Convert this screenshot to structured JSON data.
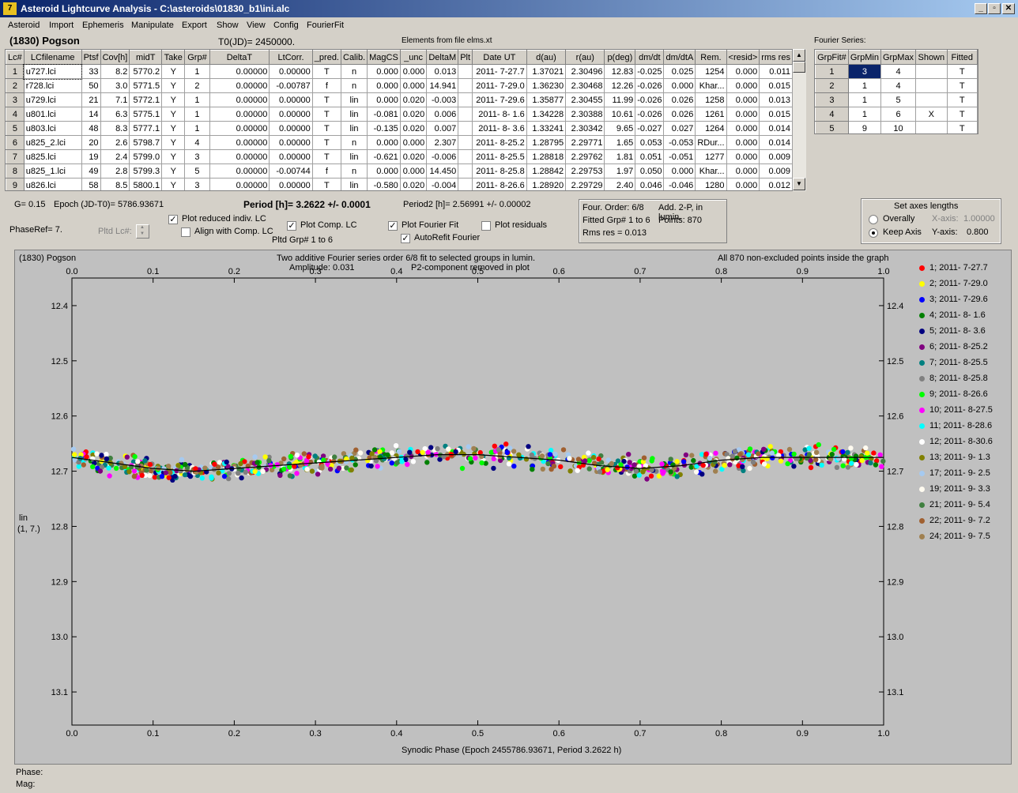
{
  "window": {
    "title": "Asteroid Lightcurve Analysis - C:\\asteroids\\01830_b1\\ini.alc",
    "app_icon": "7"
  },
  "menu": [
    "Asteroid",
    "Import",
    "Ephemeris",
    "Manipulate",
    "Export",
    "Show",
    "View",
    "Config",
    "FourierFit"
  ],
  "header": {
    "asteroid": "(1830) Pogson",
    "t0": "T0(JD)= 2450000.",
    "elements": "Elements from file elms.xt",
    "fourier_label": "Fourier Series:"
  },
  "lc_table": {
    "columns": [
      "Lc#",
      "LCfilename",
      "Ptsf",
      "Cov[h]",
      "midT",
      "Take",
      "Grp#",
      "DeltaT",
      "LtCorr.",
      "_pred.",
      "Calib.",
      "MagCS",
      "_unc",
      "DeltaM",
      "Plt",
      "Date UT",
      "d(au)",
      "r(au)",
      "p(deg)",
      "dm/dt",
      "dm/dtA",
      "Rem.",
      "<resid>",
      "rms res"
    ],
    "rows": [
      [
        "1",
        "u727.lci",
        "33",
        "8.2",
        "5770.2",
        "Y",
        "1",
        "0.00000",
        "0.00000",
        "T",
        "n",
        "0.000",
        "0.000",
        "0.013",
        "",
        "2011- 7-27.7",
        "1.37021",
        "2.30496",
        "12.83",
        "-0.025",
        "0.025",
        "1254",
        "0.000",
        "0.011"
      ],
      [
        "2",
        "r728.lci",
        "50",
        "3.0",
        "5771.5",
        "Y",
        "2",
        "0.00000",
        "-0.00787",
        "f",
        "n",
        "0.000",
        "0.000",
        "14.941",
        "",
        "2011- 7-29.0",
        "1.36230",
        "2.30468",
        "12.26",
        "-0.026",
        "0.000",
        "Khar...",
        "0.000",
        "0.015"
      ],
      [
        "3",
        "u729.lci",
        "21",
        "7.1",
        "5772.1",
        "Y",
        "1",
        "0.00000",
        "0.00000",
        "T",
        "lin",
        "0.000",
        "0.020",
        "-0.003",
        "",
        "2011- 7-29.6",
        "1.35877",
        "2.30455",
        "11.99",
        "-0.026",
        "0.026",
        "1258",
        "0.000",
        "0.013"
      ],
      [
        "4",
        "u801.lci",
        "14",
        "6.3",
        "5775.1",
        "Y",
        "1",
        "0.00000",
        "0.00000",
        "T",
        "lin",
        "-0.081",
        "0.020",
        "0.006",
        "",
        "2011- 8- 1.6",
        "1.34228",
        "2.30388",
        "10.61",
        "-0.026",
        "0.026",
        "1261",
        "0.000",
        "0.015"
      ],
      [
        "5",
        "u803.lci",
        "48",
        "8.3",
        "5777.1",
        "Y",
        "1",
        "0.00000",
        "0.00000",
        "T",
        "lin",
        "-0.135",
        "0.020",
        "0.007",
        "",
        "2011- 8- 3.6",
        "1.33241",
        "2.30342",
        "9.65",
        "-0.027",
        "0.027",
        "1264",
        "0.000",
        "0.014"
      ],
      [
        "6",
        "u825_2.lci",
        "20",
        "2.6",
        "5798.7",
        "Y",
        "4",
        "0.00000",
        "0.00000",
        "T",
        "n",
        "0.000",
        "0.000",
        "2.307",
        "",
        "2011- 8-25.2",
        "1.28795",
        "2.29771",
        "1.65",
        "0.053",
        "-0.053",
        "RDur...",
        "0.000",
        "0.014"
      ],
      [
        "7",
        "u825.lci",
        "19",
        "2.4",
        "5799.0",
        "Y",
        "3",
        "0.00000",
        "0.00000",
        "T",
        "lin",
        "-0.621",
        "0.020",
        "-0.006",
        "",
        "2011- 8-25.5",
        "1.28818",
        "2.29762",
        "1.81",
        "0.051",
        "-0.051",
        "1277",
        "0.000",
        "0.009"
      ],
      [
        "8",
        "u825_1.lci",
        "49",
        "2.8",
        "5799.3",
        "Y",
        "5",
        "0.00000",
        "-0.00744",
        "f",
        "n",
        "0.000",
        "0.000",
        "14.450",
        "",
        "2011- 8-25.8",
        "1.28842",
        "2.29753",
        "1.97",
        "0.050",
        "0.000",
        "Khar...",
        "0.000",
        "0.009"
      ],
      [
        "9",
        "u826.lci",
        "58",
        "8.5",
        "5800.1",
        "Y",
        "3",
        "0.00000",
        "0.00000",
        "T",
        "lin",
        "-0.580",
        "0.020",
        "-0.004",
        "",
        "2011- 8-26.6",
        "1.28920",
        "2.29729",
        "2.40",
        "0.046",
        "-0.046",
        "1280",
        "0.000",
        "0.012"
      ]
    ]
  },
  "fourier_table": {
    "columns": [
      "GrpFit#",
      "GrpMin",
      "GrpMax",
      "Shown",
      "Fitted"
    ],
    "rows": [
      [
        "1",
        "3",
        "4",
        "",
        "T"
      ],
      [
        "2",
        "1",
        "4",
        "",
        "T"
      ],
      [
        "3",
        "1",
        "5",
        "",
        "T"
      ],
      [
        "4",
        "1",
        "6",
        "X",
        "T"
      ],
      [
        "5",
        "9",
        "10",
        "",
        "T"
      ]
    ]
  },
  "controls": {
    "g": "G= 0.15",
    "epoch": "Epoch (JD-T0)= 5786.93671",
    "period": "Period [h]= 3.2622 +/- 0.0001",
    "period2": "Period2 [h]= 2.56991 +/- 0.00002",
    "phaseref": "PhaseRef= 7.",
    "pltd_lc": "Pltd Lc#:",
    "plot_reduced": "Plot reduced indiv. LC",
    "align_comp": "Align with Comp. LC",
    "plot_comp": "Plot Comp. LC",
    "pltd_grp": "Pltd Grp#  1   to   6",
    "plot_fourier": "Plot Fourier Fit",
    "autorefit": "AutoRefit Fourier",
    "plot_resid": "Plot residuals",
    "check_mark": "✓",
    "x_mark": "X"
  },
  "fit_info": {
    "order": "Four. Order:  6/8",
    "add": "Add. 2-P, in lumin.",
    "fitted": "Fitted Grp# 1 to 6",
    "points": "Points: 870",
    "rms": "Rms res      = 0.013"
  },
  "axes_box": {
    "title": "Set axes lengths",
    "overally": "Overally",
    "keep": "Keep Axis",
    "xaxis": "X-axis:",
    "xval": "1.00000",
    "yaxis": "Y-axis:",
    "yval": "0.800"
  },
  "plot": {
    "left_title": "(1830) Pogson",
    "center_title1": "Two additive Fourier series order 6/8 fit to selected groups in lumin.",
    "center_title2_a": "Amplitude: 0.031",
    "center_title2_b": "P2-component removed in plot",
    "right_title": "All 870 non-excluded points inside the graph",
    "ylabel1": "lin",
    "ylabel2": "(1, 7.)",
    "xlabel": "Synodic Phase (Epoch 2455786.93671, Period 3.2622 h)"
  },
  "chart_data": {
    "type": "scatter",
    "x_ticks": [
      "0.0",
      "0.1",
      "0.2",
      "0.3",
      "0.4",
      "0.5",
      "0.6",
      "0.7",
      "0.8",
      "0.9",
      "1.0"
    ],
    "y_ticks": [
      "12.4",
      "12.5",
      "12.6",
      "12.7",
      "12.8",
      "12.9",
      "13.0",
      "13.1"
    ],
    "xlim": [
      0,
      1
    ],
    "ylim": [
      12.35,
      13.16
    ],
    "y_inverted": true,
    "fit_curve": {
      "x": [
        0,
        0.05,
        0.1,
        0.15,
        0.2,
        0.25,
        0.3,
        0.35,
        0.4,
        0.45,
        0.5,
        0.55,
        0.6,
        0.65,
        0.7,
        0.75,
        0.8,
        0.85,
        0.9,
        0.95,
        1.0
      ],
      "y": [
        12.675,
        12.685,
        12.695,
        12.7,
        12.695,
        12.69,
        12.685,
        12.68,
        12.675,
        12.67,
        12.67,
        12.675,
        12.68,
        12.69,
        12.695,
        12.69,
        12.68,
        12.675,
        12.675,
        12.675,
        12.675
      ]
    },
    "series": [
      {
        "name": "1; 2011- 7-27.7",
        "color": "#ff0000"
      },
      {
        "name": "2; 2011- 7-29.0",
        "color": "#ffff00"
      },
      {
        "name": "3; 2011- 7-29.6",
        "color": "#0000ff"
      },
      {
        "name": "4; 2011- 8- 1.6",
        "color": "#008000"
      },
      {
        "name": "5; 2011- 8- 3.6",
        "color": "#000080"
      },
      {
        "name": "6; 2011- 8-25.2",
        "color": "#800080"
      },
      {
        "name": "7; 2011- 8-25.5",
        "color": "#008080"
      },
      {
        "name": "8; 2011- 8-25.8",
        "color": "#808080"
      },
      {
        "name": "9; 2011- 8-26.6",
        "color": "#00ff00"
      },
      {
        "name": "10; 2011- 8-27.5",
        "color": "#ff00ff"
      },
      {
        "name": "11; 2011- 8-28.6",
        "color": "#00ffff"
      },
      {
        "name": "12; 2011- 8-30.6",
        "color": "#ffffff"
      },
      {
        "name": "13; 2011- 9- 1.3",
        "color": "#808000"
      },
      {
        "name": "17; 2011- 9- 2.5",
        "color": "#a6caf0"
      },
      {
        "name": "19; 2011- 9- 3.3",
        "color": "#fffbf0"
      },
      {
        "name": "21; 2011- 9- 5.4",
        "color": "#408040"
      },
      {
        "name": "22; 2011- 9- 7.2",
        "color": "#a06030"
      },
      {
        "name": "24; 2011- 9- 7.5",
        "color": "#a08050"
      }
    ]
  },
  "status": {
    "phase": "Phase:",
    "mag": "Mag:"
  }
}
